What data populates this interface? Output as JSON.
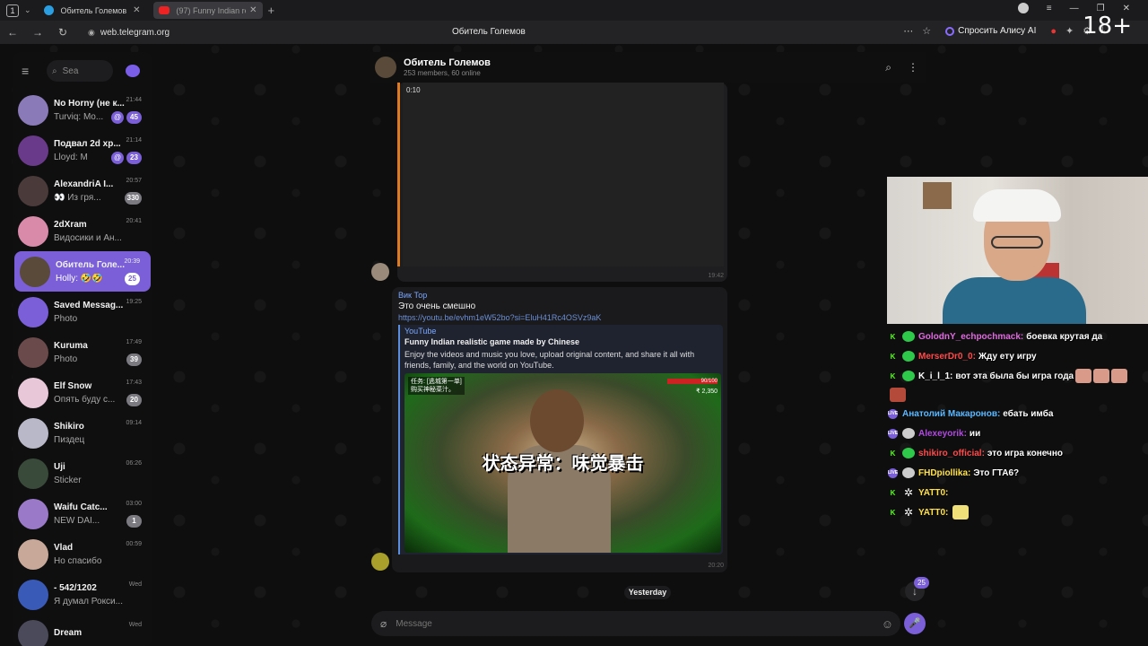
{
  "browser": {
    "tab_count": "1",
    "tabs": [
      {
        "title": "Обитель Големов"
      },
      {
        "title": "(97) Funny Indian realis"
      }
    ],
    "url": "web.telegram.org",
    "page_title": "Обитель Големов",
    "alice_label": "Спросить Алису AI",
    "age_label": "18+"
  },
  "sidebar": {
    "search_placeholder": "Search",
    "chats": [
      {
        "name": "No Horny (не к...",
        "time": "21:44",
        "preview": "Turviq: Mo...",
        "badge": "45",
        "color": "#8a7ab8"
      },
      {
        "name": "Подвал 2d хр...",
        "time": "21:14",
        "preview": "Lloyd: M",
        "badge": "23",
        "color": "#6a3a8a"
      },
      {
        "name": "AlexandriA I...",
        "time": "20:57",
        "preview": "👀 Из гря...",
        "badge": "330",
        "color": "#4a3a3a"
      },
      {
        "name": "2dXram",
        "time": "20:41",
        "preview": "Видосики и Ан...",
        "badge": "",
        "color": "#d88aa8"
      },
      {
        "name": "Обитель Голе...",
        "time": "20:39",
        "preview": "Holly: 🤣🤣",
        "badge": "25",
        "color": "#5a4a3a"
      },
      {
        "name": "Saved Messag...",
        "time": "19:25",
        "preview": "Photo",
        "badge": "",
        "color": "#7a5fd8"
      },
      {
        "name": "Kuruma",
        "time": "17:49",
        "preview": "Photo",
        "badge": "39",
        "color": "#6a4a4a"
      },
      {
        "name": "Elf Snow",
        "time": "17:43",
        "preview": "Опять буду с...",
        "badge": "20",
        "color": "#e8c8d8"
      },
      {
        "name": "Shikiro",
        "time": "09:14",
        "preview": "Пиздец",
        "badge": "",
        "color": "#b8b8c8"
      },
      {
        "name": "Uji",
        "time": "06:26",
        "preview": "Sticker",
        "badge": "",
        "color": "#3a4a3a"
      },
      {
        "name": "Waifu Catc...",
        "time": "03:00",
        "preview": "NEW DAI...",
        "badge": "1",
        "color": "#9a7ac8"
      },
      {
        "name": "Vlad",
        "time": "00:59",
        "preview": "Но спасибо",
        "badge": "",
        "color": "#c8a898"
      },
      {
        "name": "- 542/1202",
        "time": "Wed",
        "preview": "Я думал Рокси...",
        "badge": "",
        "color": "#3a5ab8"
      },
      {
        "name": "Dream",
        "time": "Wed",
        "preview": "",
        "badge": "",
        "color": "#4a4a5a"
      }
    ]
  },
  "chat": {
    "title": "Обитель Големов",
    "subtitle": "253 members, 60 online",
    "video_duration": "0:10",
    "video_time": "19:42",
    "message": {
      "author": "Вик Тор",
      "text": "Это очень смешно",
      "link": "https://youtu.be/evhm1eW52bo?si=EluH41Rc4OSVz9aK",
      "preview_site": "YouTube",
      "preview_title": "Funny Indian realistic game made by Chinese",
      "preview_desc": "Enjoy the videos and music you love, upload original content, and share it all with friends, family, and the world on YouTube.",
      "thumb_caption": "状态异常：味觉暴击",
      "thumb_hud_line1": "任务: [逃城第一单]",
      "thumb_hud_line2": "购买神秘菜汁。",
      "thumb_hp": "90/100",
      "thumb_money": "₹ 2,350",
      "time": "20:20"
    },
    "date_separator": "Yesterday",
    "scroll_badge": "25",
    "composer_placeholder": "Message"
  },
  "stream_chat": [
    {
      "platform": "K",
      "nick": "GolodnY_echpochmack:",
      "nick_color": "#e06adf",
      "text": "боевка крутая да"
    },
    {
      "platform": "K",
      "nick": "MerserDr0_0:",
      "nick_color": "#ff4a4a",
      "text": "Жду ету игру"
    },
    {
      "platform": "K",
      "nick": "K_i_l_1:",
      "nick_color": "#ffffff",
      "text": "вот эта была бы игра года"
    },
    {
      "platform": "V",
      "nick": "Анатолий Макаронов:",
      "nick_color": "#5ab8ff",
      "text": "ебать имба"
    },
    {
      "platform": "V",
      "nick": "Alexeyorik:",
      "nick_color": "#b04adf",
      "text": "ии"
    },
    {
      "platform": "K",
      "nick": "shikiro_official:",
      "nick_color": "#ff4a4a",
      "text": "это игра конечно"
    },
    {
      "platform": "V",
      "nick": "FHDpiollika:",
      "nick_color": "#ffe24a",
      "text": "Это ГТА6?"
    },
    {
      "platform": "K",
      "nick": "YATT0:",
      "nick_color": "#ffe24a",
      "text": ""
    },
    {
      "platform": "K",
      "nick": "YATT0:",
      "nick_color": "#ffe24a",
      "text": ""
    }
  ]
}
